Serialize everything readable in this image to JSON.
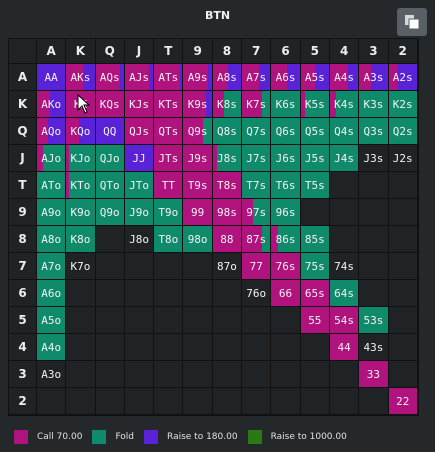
{
  "title": "BTN",
  "colors": {
    "call": "#b0137e",
    "fold": "#0f8a6b",
    "raise180": "#5a22d6",
    "raise1000": "#2a7a14",
    "empty": "#202326"
  },
  "ranks": [
    "A",
    "K",
    "Q",
    "J",
    "T",
    "9",
    "8",
    "7",
    "6",
    "5",
    "4",
    "3",
    "2"
  ],
  "legend": [
    {
      "label": "Call 70.00",
      "color": "#b0137e"
    },
    {
      "label": "Fold",
      "color": "#0f8a6b"
    },
    {
      "label": "Raise to 180.00",
      "color": "#5a22d6"
    },
    {
      "label": "Raise to 1000.00",
      "color": "#2a7a14"
    }
  ],
  "hands": [
    [
      "AA",
      "AKs",
      "AQs",
      "AJs",
      "ATs",
      "A9s",
      "A8s",
      "A7s",
      "A6s",
      "A5s",
      "A4s",
      "A3s",
      "A2s"
    ],
    [
      "AKo",
      "KK",
      "KQs",
      "KJs",
      "KTs",
      "K9s",
      "K8s",
      "K7s",
      "K6s",
      "K5s",
      "K4s",
      "K3s",
      "K2s"
    ],
    [
      "AQo",
      "KQo",
      "QQ",
      "QJs",
      "QTs",
      "Q9s",
      "Q8s",
      "Q7s",
      "Q6s",
      "Q5s",
      "Q4s",
      "Q3s",
      "Q2s"
    ],
    [
      "AJo",
      "KJo",
      "QJo",
      "JJ",
      "JTs",
      "J9s",
      "J8s",
      "J7s",
      "J6s",
      "J5s",
      "J4s",
      "J3s",
      "J2s"
    ],
    [
      "ATo",
      "KTo",
      "QTo",
      "JTo",
      "TT",
      "T9s",
      "T8s",
      "T7s",
      "T6s",
      "T5s",
      "",
      "",
      ""
    ],
    [
      "A9o",
      "K9o",
      "Q9o",
      "J9o",
      "T9o",
      "99",
      "98s",
      "97s",
      "96s",
      "",
      "",
      "",
      ""
    ],
    [
      "A8o",
      "K8o",
      "",
      "J8o",
      "T8o",
      "98o",
      "88",
      "87s",
      "86s",
      "85s",
      "",
      "",
      ""
    ],
    [
      "A7o",
      "K7o",
      "",
      "",
      "",
      "",
      "87o",
      "77",
      "76s",
      "75s",
      "74s",
      "",
      ""
    ],
    [
      "A6o",
      "",
      "",
      "",
      "",
      "",
      "",
      "76o",
      "66",
      "65s",
      "64s",
      "",
      ""
    ],
    [
      "A5o",
      "",
      "",
      "",
      "",
      "",
      "",
      "",
      "",
      "55",
      "54s",
      "53s",
      ""
    ],
    [
      "A4o",
      "",
      "",
      "",
      "",
      "",
      "",
      "",
      "",
      "",
      "44",
      "43s",
      ""
    ],
    [
      "A3o",
      "",
      "",
      "",
      "",
      "",
      "",
      "",
      "",
      "",
      "",
      "33",
      ""
    ],
    [
      "",
      "",
      "",
      "",
      "",
      "",
      "",
      "",
      "",
      "",
      "",
      "",
      "22"
    ]
  ],
  "mix": [
    [
      [
        0,
        0,
        100
      ],
      [
        60,
        0,
        40
      ],
      [
        85,
        0,
        15
      ],
      [
        85,
        0,
        15
      ],
      [
        90,
        0,
        10
      ],
      [
        85,
        0,
        15
      ],
      [
        55,
        0,
        45
      ],
      [
        60,
        0,
        40
      ],
      [
        55,
        0,
        45
      ],
      [
        50,
        0,
        50
      ],
      [
        65,
        0,
        35
      ],
      [
        40,
        0,
        60
      ],
      [
        35,
        0,
        65
      ]
    ],
    [
      [
        45,
        0,
        55
      ],
      [
        100,
        0,
        0
      ],
      [
        100,
        0,
        0
      ],
      [
        100,
        0,
        0
      ],
      [
        100,
        0,
        0
      ],
      [
        80,
        0,
        20
      ],
      [
        40,
        60,
        0
      ],
      [
        70,
        30,
        0
      ],
      [
        0,
        100,
        0
      ],
      [
        15,
        85,
        0
      ],
      [
        20,
        80,
        0
      ],
      [
        0,
        100,
        0
      ],
      [
        0,
        100,
        0
      ]
    ],
    [
      [
        40,
        0,
        60
      ],
      [
        45,
        0,
        55
      ],
      [
        0,
        0,
        100
      ],
      [
        100,
        0,
        0
      ],
      [
        100,
        0,
        0
      ],
      [
        70,
        30,
        0
      ],
      [
        0,
        100,
        0
      ],
      [
        0,
        100,
        0
      ],
      [
        0,
        100,
        0
      ],
      [
        0,
        100,
        0
      ],
      [
        0,
        100,
        0
      ],
      [
        0,
        100,
        0
      ],
      [
        0,
        100,
        0
      ]
    ],
    [
      [
        20,
        80,
        0
      ],
      [
        10,
        90,
        0
      ],
      [
        0,
        100,
        0
      ],
      [
        0,
        0,
        100
      ],
      [
        100,
        0,
        0
      ],
      [
        100,
        0,
        0
      ],
      [
        15,
        85,
        0
      ],
      [
        0,
        100,
        0
      ],
      [
        0,
        100,
        0
      ],
      [
        0,
        100,
        0
      ],
      [
        0,
        100,
        0
      ],
      [
        0,
        0,
        0
      ],
      [
        0,
        0,
        0
      ]
    ],
    [
      [
        0,
        100,
        0
      ],
      [
        10,
        90,
        0
      ],
      [
        0,
        100,
        0
      ],
      [
        0,
        100,
        0
      ],
      [
        100,
        0,
        0
      ],
      [
        100,
        0,
        0
      ],
      [
        100,
        0,
        0
      ],
      [
        0,
        100,
        0
      ],
      [
        0,
        100,
        0
      ],
      [
        0,
        100,
        0
      ],
      [
        0,
        0,
        0
      ],
      [
        0,
        0,
        0
      ],
      [
        0,
        0,
        0
      ]
    ],
    [
      [
        0,
        100,
        0
      ],
      [
        0,
        100,
        0
      ],
      [
        0,
        100,
        0
      ],
      [
        0,
        100,
        0
      ],
      [
        0,
        100,
        0
      ],
      [
        100,
        0,
        0
      ],
      [
        100,
        0,
        0
      ],
      [
        40,
        60,
        0
      ],
      [
        0,
        100,
        0
      ],
      [
        0,
        0,
        0
      ],
      [
        0,
        0,
        0
      ],
      [
        0,
        0,
        0
      ],
      [
        0,
        0,
        0
      ]
    ],
    [
      [
        0,
        100,
        0
      ],
      [
        0,
        100,
        0
      ],
      [
        0,
        0,
        0
      ],
      [
        0,
        0,
        0
      ],
      [
        0,
        100,
        0
      ],
      [
        0,
        100,
        0
      ],
      [
        100,
        0,
        0
      ],
      [
        70,
        30,
        0
      ],
      [
        25,
        75,
        0
      ],
      [
        0,
        100,
        0
      ],
      [
        0,
        0,
        0
      ],
      [
        0,
        0,
        0
      ],
      [
        0,
        0,
        0
      ]
    ],
    [
      [
        0,
        100,
        0
      ],
      [
        0,
        0,
        0
      ],
      [
        0,
        0,
        0
      ],
      [
        0,
        0,
        0
      ],
      [
        0,
        0,
        0
      ],
      [
        0,
        0,
        0
      ],
      [
        0,
        0,
        0
      ],
      [
        100,
        0,
        0
      ],
      [
        100,
        0,
        0
      ],
      [
        0,
        100,
        0
      ],
      [
        0,
        0,
        0
      ],
      [
        0,
        0,
        0
      ],
      [
        0,
        0,
        0
      ]
    ],
    [
      [
        0,
        100,
        0
      ],
      [
        0,
        0,
        0
      ],
      [
        0,
        0,
        0
      ],
      [
        0,
        0,
        0
      ],
      [
        0,
        0,
        0
      ],
      [
        0,
        0,
        0
      ],
      [
        0,
        0,
        0
      ],
      [
        0,
        0,
        0
      ],
      [
        100,
        0,
        0
      ],
      [
        100,
        0,
        0
      ],
      [
        0,
        100,
        0
      ],
      [
        0,
        0,
        0
      ],
      [
        0,
        0,
        0
      ]
    ],
    [
      [
        0,
        100,
        0
      ],
      [
        0,
        0,
        0
      ],
      [
        0,
        0,
        0
      ],
      [
        0,
        0,
        0
      ],
      [
        0,
        0,
        0
      ],
      [
        0,
        0,
        0
      ],
      [
        0,
        0,
        0
      ],
      [
        0,
        0,
        0
      ],
      [
        0,
        0,
        0
      ],
      [
        100,
        0,
        0
      ],
      [
        100,
        0,
        0
      ],
      [
        0,
        100,
        0
      ],
      [
        0,
        0,
        0
      ]
    ],
    [
      [
        0,
        100,
        0
      ],
      [
        0,
        0,
        0
      ],
      [
        0,
        0,
        0
      ],
      [
        0,
        0,
        0
      ],
      [
        0,
        0,
        0
      ],
      [
        0,
        0,
        0
      ],
      [
        0,
        0,
        0
      ],
      [
        0,
        0,
        0
      ],
      [
        0,
        0,
        0
      ],
      [
        0,
        0,
        0
      ],
      [
        100,
        0,
        0
      ],
      [
        0,
        0,
        0
      ],
      [
        0,
        0,
        0
      ]
    ],
    [
      [
        0,
        0,
        0
      ],
      [
        0,
        0,
        0
      ],
      [
        0,
        0,
        0
      ],
      [
        0,
        0,
        0
      ],
      [
        0,
        0,
        0
      ],
      [
        0,
        0,
        0
      ],
      [
        0,
        0,
        0
      ],
      [
        0,
        0,
        0
      ],
      [
        0,
        0,
        0
      ],
      [
        0,
        0,
        0
      ],
      [
        0,
        0,
        0
      ],
      [
        100,
        0,
        0
      ],
      [
        0,
        0,
        0
      ]
    ],
    [
      [
        0,
        0,
        0
      ],
      [
        0,
        0,
        0
      ],
      [
        0,
        0,
        0
      ],
      [
        0,
        0,
        0
      ],
      [
        0,
        0,
        0
      ],
      [
        0,
        0,
        0
      ],
      [
        0,
        0,
        0
      ],
      [
        0,
        0,
        0
      ],
      [
        0,
        0,
        0
      ],
      [
        0,
        0,
        0
      ],
      [
        0,
        0,
        0
      ],
      [
        0,
        0,
        0
      ],
      [
        100,
        0,
        0
      ]
    ]
  ]
}
